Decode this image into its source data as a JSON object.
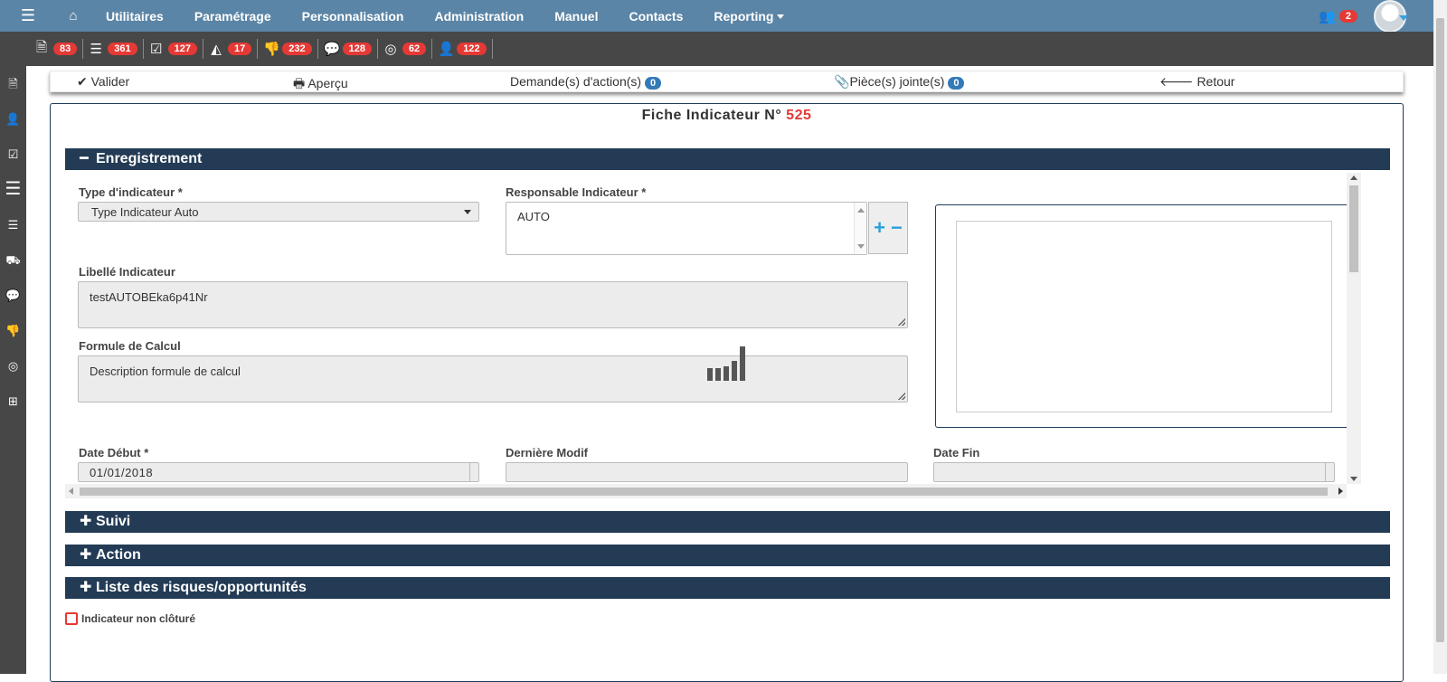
{
  "nav": {
    "items": [
      "Utilitaires",
      "Paramétrage",
      "Personnalisation",
      "Administration",
      "Manuel",
      "Contacts",
      "Reporting"
    ],
    "notifications_count": "2"
  },
  "toolbar": {
    "items": [
      {
        "icon": "document-icon",
        "count": "83"
      },
      {
        "icon": "server-icon",
        "count": "361"
      },
      {
        "icon": "check-square-icon",
        "count": "127"
      },
      {
        "icon": "area-chart-icon",
        "count": "17"
      },
      {
        "icon": "thumbs-down-icon",
        "count": "232"
      },
      {
        "icon": "comment-icon",
        "count": "128"
      },
      {
        "icon": "life-ring-icon",
        "count": "62"
      },
      {
        "icon": "user-icon",
        "count": "122"
      }
    ]
  },
  "actions": {
    "validate": "Valider",
    "preview": "Aperçu",
    "requests": "Demande(s) d'action(s)",
    "requests_count": "0",
    "attachments": "Pièce(s) jointe(s)",
    "attachments_count": "0",
    "back": "Retour"
  },
  "form": {
    "title": "Fiche Indicateur N°",
    "number": "525",
    "section_enregistrement": "Enregistrement",
    "type_label": "Type d'indicateur *",
    "type_value": "Type Indicateur Auto",
    "responsable_label": "Responsable Indicateur *",
    "responsable_value": "AUTO",
    "libelle_label": "Libellé Indicateur",
    "libelle_value": "testAUTOBEka6p41Nr",
    "formule_label": "Formule de Calcul",
    "formule_value": "Description formule de calcul",
    "date_debut_label": "Date Début *",
    "date_debut_value": "01/01/2018",
    "derniere_modif_label": "Dernière Modif",
    "date_fin_label": "Date Fin",
    "section_suivi": "Suivi",
    "section_action": "Action",
    "section_risques": "Liste des risques/opportunités",
    "checkbox_label": "Indicateur non clôturé"
  }
}
